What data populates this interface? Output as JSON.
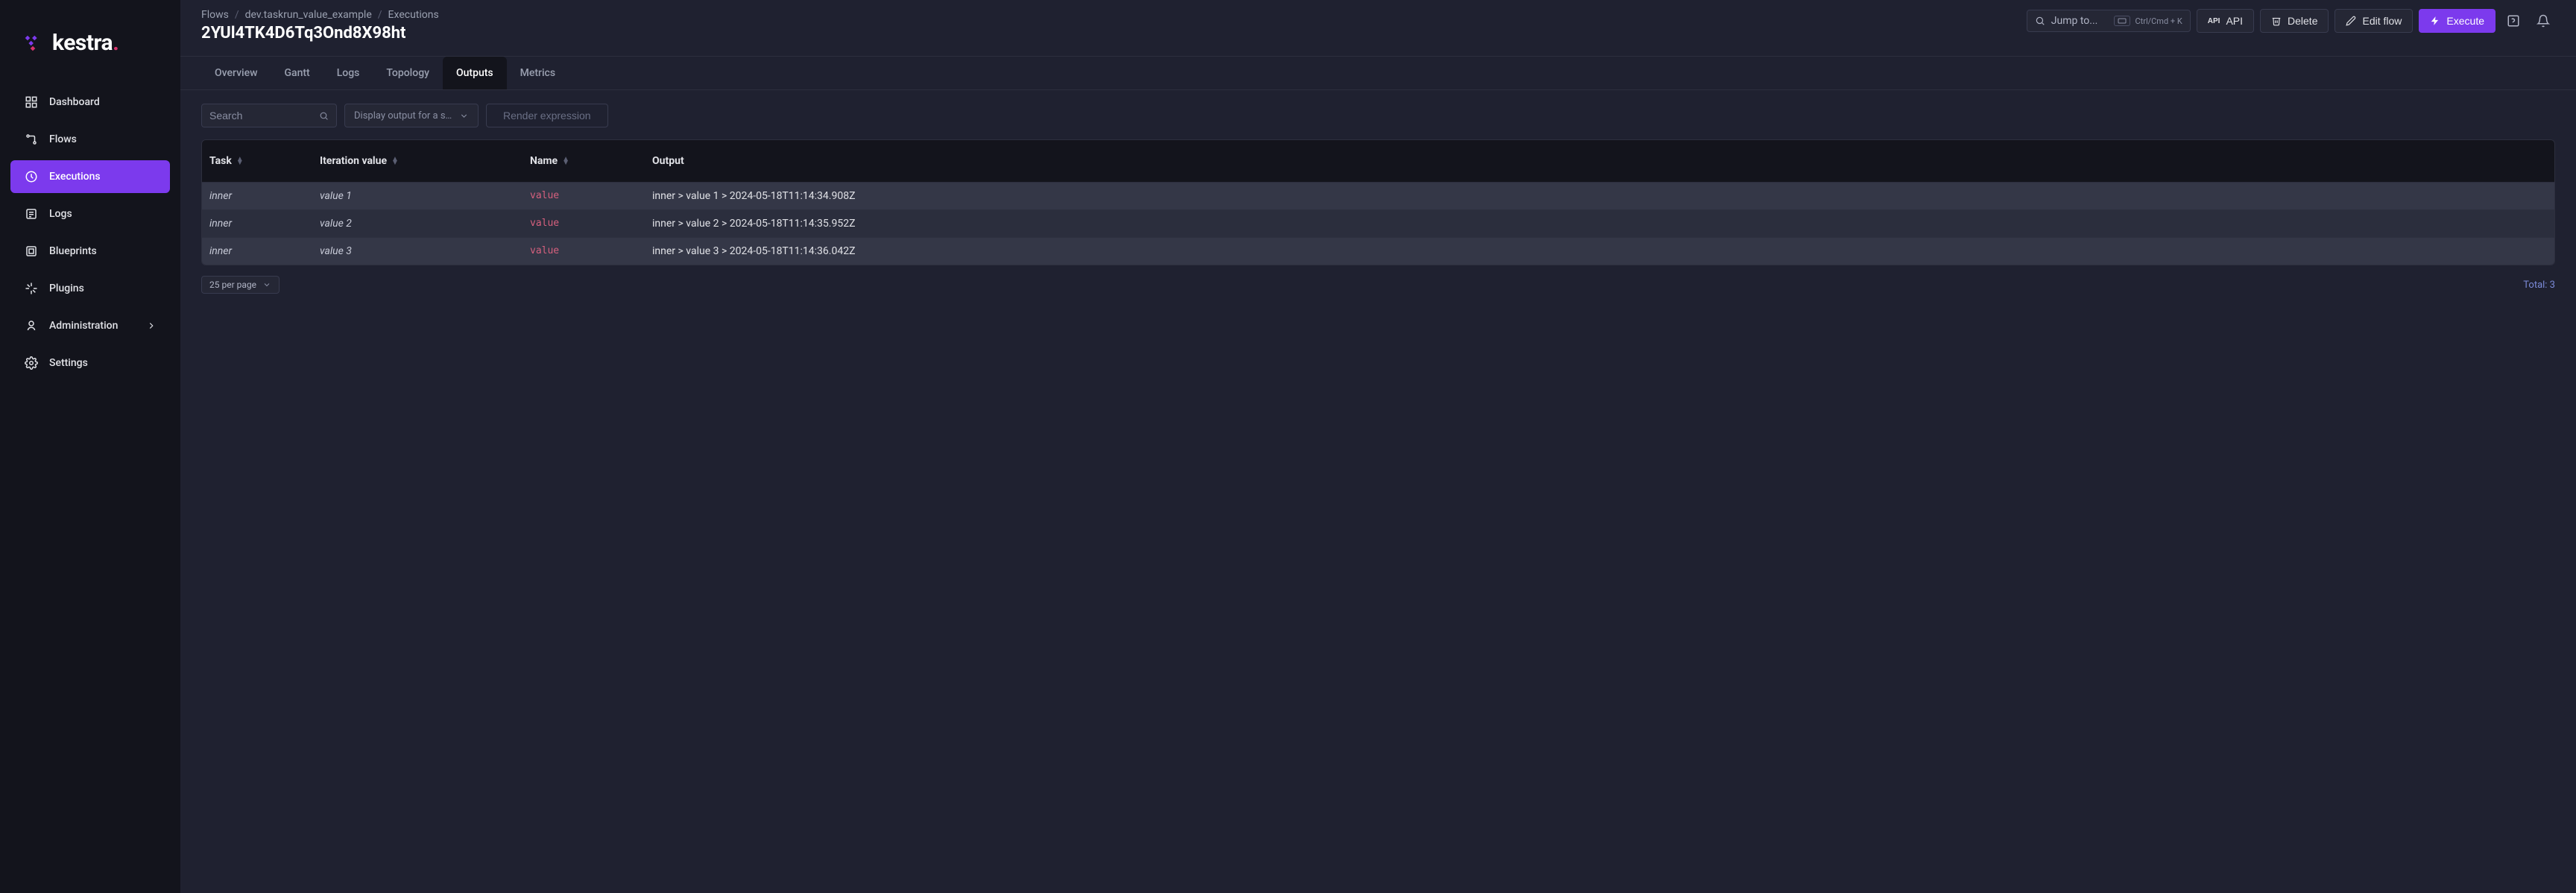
{
  "brand": "kestra",
  "sidebar": {
    "items": [
      {
        "label": "Dashboard",
        "icon": "dashboard-icon"
      },
      {
        "label": "Flows",
        "icon": "flows-icon"
      },
      {
        "label": "Executions",
        "icon": "executions-icon",
        "active": true
      },
      {
        "label": "Logs",
        "icon": "logs-icon"
      },
      {
        "label": "Blueprints",
        "icon": "blueprints-icon"
      },
      {
        "label": "Plugins",
        "icon": "plugins-icon"
      },
      {
        "label": "Administration",
        "icon": "admin-icon",
        "children": true
      },
      {
        "label": "Settings",
        "icon": "settings-icon"
      }
    ]
  },
  "breadcrumbs": [
    {
      "label": "Flows"
    },
    {
      "label": "dev.taskrun_value_example"
    },
    {
      "label": "Executions"
    }
  ],
  "page_title": "2YUl4TK4D6Tq3Ond8X98ht",
  "jump": {
    "placeholder": "Jump to...",
    "shortcut": "Ctrl/Cmd + K"
  },
  "actions": {
    "api": "API",
    "delete": "Delete",
    "edit": "Edit flow",
    "execute": "Execute"
  },
  "tabs": [
    {
      "label": "Overview"
    },
    {
      "label": "Gantt"
    },
    {
      "label": "Logs"
    },
    {
      "label": "Topology"
    },
    {
      "label": "Outputs",
      "active": true
    },
    {
      "label": "Metrics"
    }
  ],
  "filters": {
    "search_placeholder": "Search",
    "display_output": "Display output for a s…",
    "render": "Render expression"
  },
  "table": {
    "headers": {
      "task": "Task",
      "iteration": "Iteration value",
      "name": "Name",
      "output": "Output"
    },
    "rows": [
      {
        "task": "inner",
        "iteration": "value 1",
        "name": "value",
        "output": "inner > value 1 > 2024-05-18T11:14:34.908Z"
      },
      {
        "task": "inner",
        "iteration": "value 2",
        "name": "value",
        "output": "inner > value 2 > 2024-05-18T11:14:35.952Z"
      },
      {
        "task": "inner",
        "iteration": "value 3",
        "name": "value",
        "output": "inner > value 3 > 2024-05-18T11:14:36.042Z"
      }
    ]
  },
  "pagination": {
    "per_page": "25 per page",
    "total": "Total: 3"
  }
}
